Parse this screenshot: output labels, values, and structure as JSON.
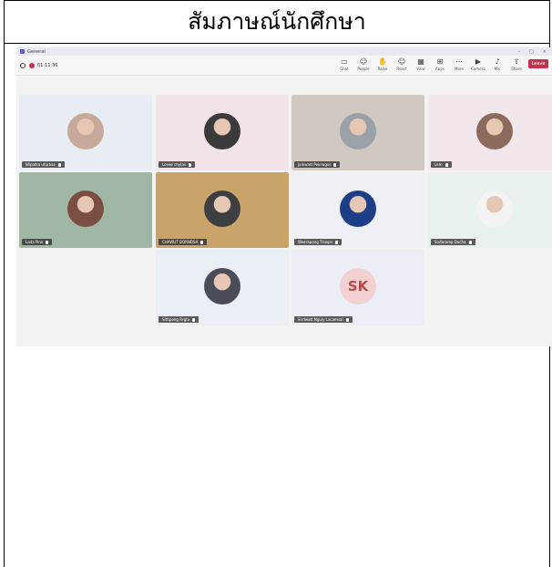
{
  "document": {
    "title": "สัมภาษณ์นักศึกษา"
  },
  "meeting": {
    "window_title": "General",
    "timer": "01:11:36",
    "tools": [
      {
        "icon": "chat-icon",
        "label": "Chat"
      },
      {
        "icon": "people-icon",
        "label": "People"
      },
      {
        "icon": "raise-hand-icon",
        "label": "Raise"
      },
      {
        "icon": "react-icon",
        "label": "React"
      },
      {
        "icon": "view-icon",
        "label": "View"
      },
      {
        "icon": "apps-icon",
        "label": "Apps"
      },
      {
        "icon": "more-icon",
        "label": "More"
      },
      {
        "icon": "camera-icon",
        "label": "Camera"
      },
      {
        "icon": "mic-icon",
        "label": "Mic"
      },
      {
        "icon": "share-icon",
        "label": "Share"
      }
    ],
    "leave_label": "Leave",
    "participants": [
      {
        "name": "Wipatsa uturasa",
        "bg": "#e8edf3",
        "avatar": "#c7a99a"
      },
      {
        "name": "Lovee chylas",
        "bg": "#f3e4ea",
        "avatar": "#3a3a3a"
      },
      {
        "name": "Jainwatt Pekrwgos",
        "bg": "#cfc9c1",
        "avatar": "#9aa1a8"
      },
      {
        "name": "Lem",
        "bg": "#f1e6ea",
        "avatar": "#8c6b5d"
      },
      {
        "name": "Lada Pinn",
        "bg": "#9fb7a3",
        "avatar": "#7a4f42"
      },
      {
        "name": "CHAWUT DORNDSA",
        "bg": "#c9a36a",
        "avatar": "#3e3f41"
      },
      {
        "name": "Weerapong Tlswpn",
        "bg": "#eef0f5",
        "avatar": "#1d3e86"
      },
      {
        "name": "Sodaramp Dacha",
        "bg": "#e9f1ef",
        "avatar": "#f3f3f3"
      },
      {
        "name": "Sittipong Rrgta",
        "bg": "#eaeef5",
        "avatar": "#4a4d57"
      },
      {
        "name": "Sirdwatt Nguiy Lacamsal",
        "bg": "#eceef6",
        "initials": "SK"
      }
    ]
  }
}
